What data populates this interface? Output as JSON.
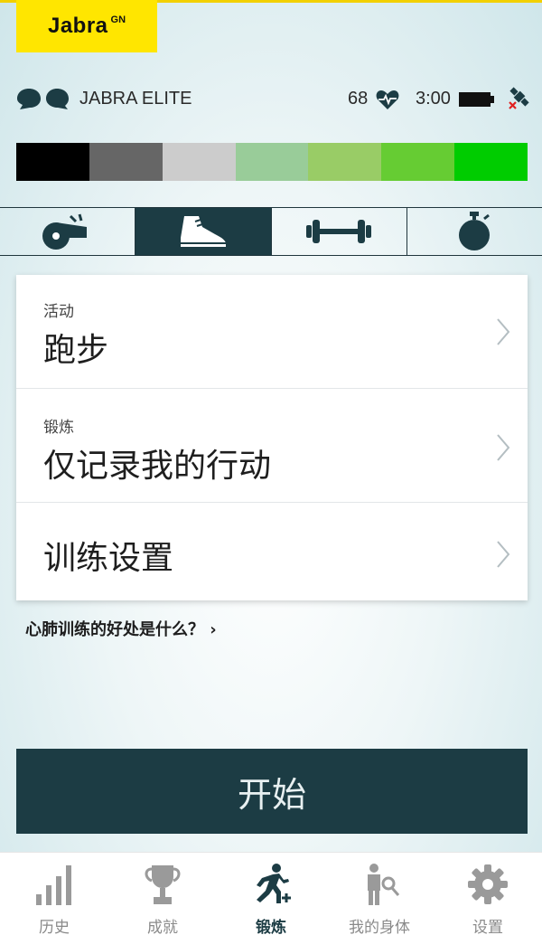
{
  "logo": {
    "text": "Jabra",
    "sup": "GN"
  },
  "status": {
    "device_name": "JABRA ELITE",
    "heart_rate": "68",
    "battery_time": "3:00"
  },
  "zones": [
    "#000000",
    "#666666",
    "#cccccc",
    "#99cc99",
    "#99cc66",
    "#66cc33",
    "#00cc00"
  ],
  "mode_tabs": [
    {
      "icon": "whistle-icon",
      "active": false
    },
    {
      "icon": "running-shoe-icon",
      "active": true
    },
    {
      "icon": "dumbbell-icon",
      "active": false
    },
    {
      "icon": "stopwatch-icon",
      "active": false
    }
  ],
  "settings": {
    "activity": {
      "sub": "活动",
      "value": "跑步"
    },
    "workout": {
      "sub": "锻炼",
      "value": "仅记录我的行动"
    },
    "training": {
      "value": "训练设置"
    }
  },
  "help_link": "心肺训练的好处是什么？ ›",
  "start_button": "开始",
  "bottom_nav": [
    {
      "label": "历史",
      "icon": "bar-chart-icon",
      "active": false
    },
    {
      "label": "成就",
      "icon": "trophy-icon",
      "active": false
    },
    {
      "label": "锻炼",
      "icon": "runner-plus-icon",
      "active": true
    },
    {
      "label": "我的身体",
      "icon": "body-measure-icon",
      "active": false
    },
    {
      "label": "设置",
      "icon": "gear-icon",
      "active": false
    }
  ],
  "colors": {
    "accent_dark": "#1c3c44",
    "brand_yellow": "#ffe600"
  }
}
